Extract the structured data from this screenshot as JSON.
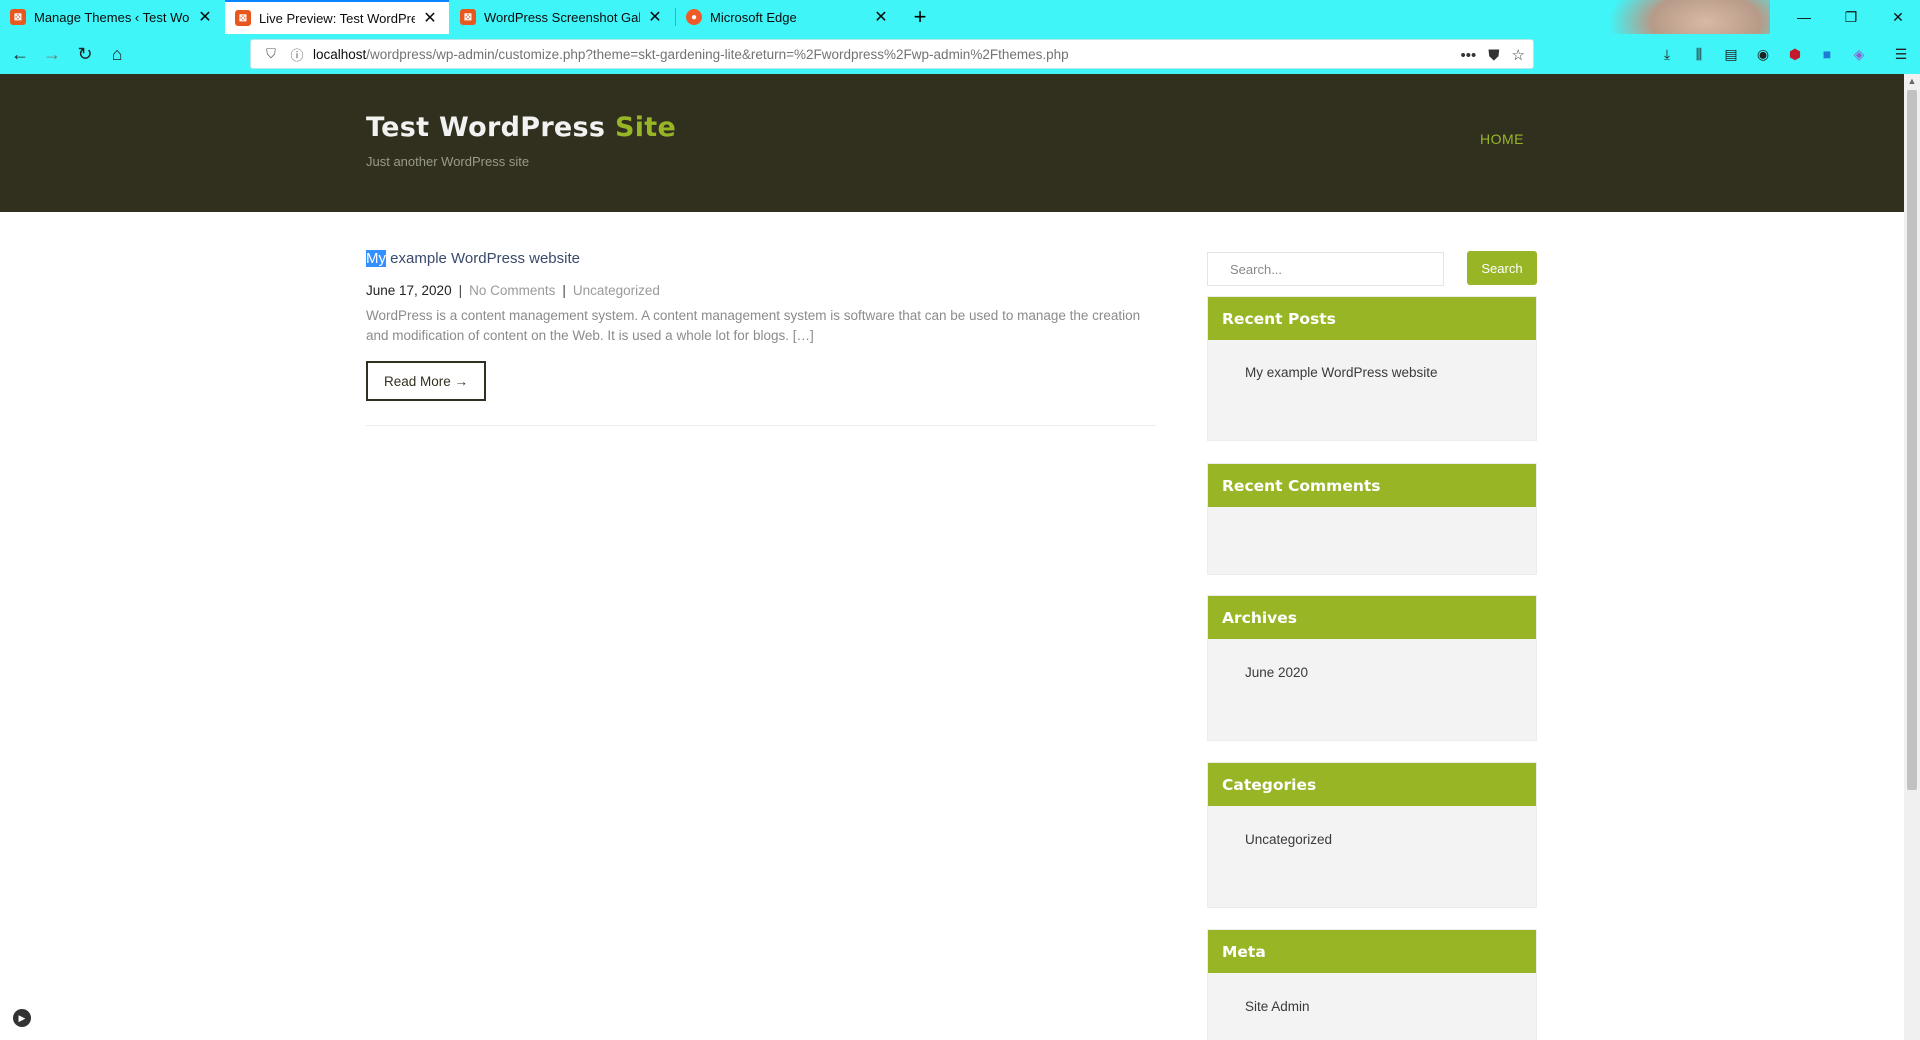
{
  "browser": {
    "tabs": [
      {
        "title": "Manage Themes ‹ Test WordPr",
        "icon": "xampp-icon",
        "active": false
      },
      {
        "title": "Live Preview: Test WordPress Si",
        "icon": "xampp-icon",
        "active": true
      },
      {
        "title": "WordPress Screenshot Gallery",
        "icon": "xampp-icon",
        "active": false
      },
      {
        "title": "Microsoft Edge",
        "icon": "reddit-icon",
        "active": false
      }
    ],
    "url_host": "localhost",
    "url_path": "/wordpress/wp-admin/customize.php?theme=skt-gardening-lite&return=%2Fwordpress%2Fwp-admin%2Fthemes.php",
    "chrome_color": "#3ff5f8"
  },
  "site": {
    "title_main": "Test WordPress ",
    "title_accent": "Site",
    "tagline": "Just another WordPress site",
    "nav_home": "HOME",
    "accent_color": "#98b526",
    "header_color": "#31301f"
  },
  "post": {
    "title_selected": "My",
    "title_rest": " example WordPress website",
    "date": "June 17, 2020",
    "comments": "No Comments",
    "category": "Uncategorized",
    "excerpt": "WordPress is a content management system. A content management system is software that can be used to manage the creation and modification of content on the Web. It is used a whole lot for blogs. […]",
    "read_more": "Read More →"
  },
  "sidebar": {
    "search_placeholder": "Search...",
    "search_button": "Search",
    "recent_posts_title": "Recent Posts",
    "recent_posts": [
      "My example WordPress website"
    ],
    "recent_comments_title": "Recent Comments",
    "archives_title": "Archives",
    "archives": [
      "June 2020"
    ],
    "categories_title": "Categories",
    "categories": [
      "Uncategorized"
    ],
    "meta_title": "Meta",
    "meta": [
      "Site Admin"
    ]
  }
}
